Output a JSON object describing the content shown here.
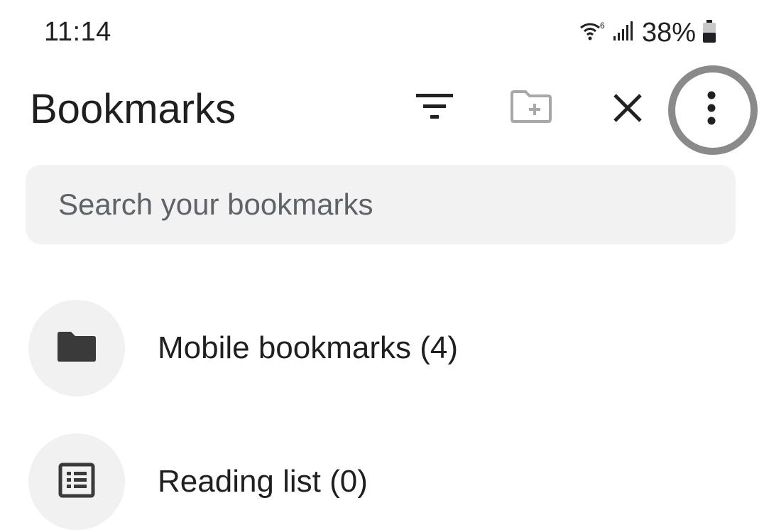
{
  "status_bar": {
    "time": "11:14",
    "wifi_icon": "wifi-6-icon",
    "signal_icon": "cell-signal-icon",
    "battery_percent": "38%",
    "battery_icon": "battery-icon",
    "battery_level": 0.38
  },
  "header": {
    "title": "Bookmarks",
    "filter_icon": "filter-icon",
    "new_folder_icon": "new-folder-icon",
    "close_icon": "close-icon",
    "more_icon": "more-vert-icon",
    "highlight_color": "#8a8a8a"
  },
  "search": {
    "placeholder": "Search your bookmarks",
    "value": ""
  },
  "list": {
    "items": [
      {
        "label": "Mobile bookmarks (4)",
        "icon": "folder-icon"
      },
      {
        "label": "Reading list (0)",
        "icon": "reading-list-icon"
      }
    ]
  }
}
